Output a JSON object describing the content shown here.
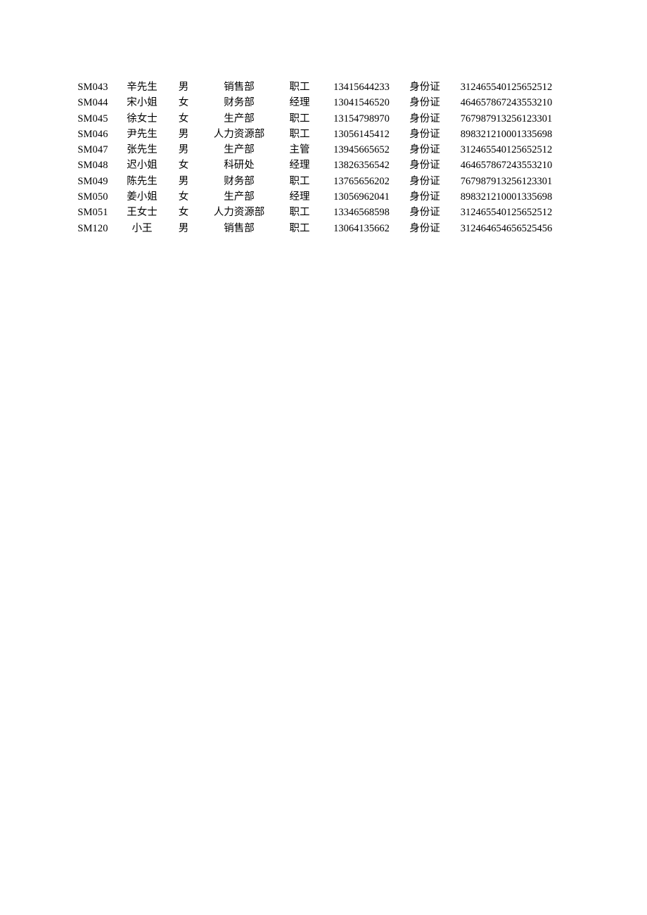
{
  "document": {
    "type": "employee-record-table",
    "page_background": "#ffffff",
    "text_color": "#000000",
    "has_header_row": false,
    "has_gridlines": false,
    "row_count": 10,
    "column_count": 7
  },
  "table": {
    "columns": [
      {
        "key": "id",
        "semantic": "employee-id"
      },
      {
        "key": "name",
        "semantic": "employee-name"
      },
      {
        "key": "gender",
        "semantic": "gender"
      },
      {
        "key": "department",
        "semantic": "department"
      },
      {
        "key": "position",
        "semantic": "position"
      },
      {
        "key": "phone",
        "semantic": "phone-number"
      },
      {
        "key": "id_type",
        "semantic": "id-document-type"
      },
      {
        "key": "id_number",
        "semantic": "id-document-number"
      }
    ],
    "rows": [
      {
        "id": "SM043",
        "name": "辛先生",
        "gender": "男",
        "department": "销售部",
        "position": "职工",
        "phone": "13415644233",
        "id_type": "身份证",
        "id_number": "312465540125652512"
      },
      {
        "id": "SM044",
        "name": "宋小姐",
        "gender": "女",
        "department": "财务部",
        "position": "经理",
        "phone": "13041546520",
        "id_type": "身份证",
        "id_number": "464657867243553210"
      },
      {
        "id": "SM045",
        "name": "徐女士",
        "gender": "女",
        "department": "生产部",
        "position": "职工",
        "phone": "13154798970",
        "id_type": "身份证",
        "id_number": "767987913256123301"
      },
      {
        "id": "SM046",
        "name": "尹先生",
        "gender": "男",
        "department": "人力资源部",
        "position": "职工",
        "phone": "13056145412",
        "id_type": "身份证",
        "id_number": "898321210001335698"
      },
      {
        "id": "SM047",
        "name": "张先生",
        "gender": "男",
        "department": "生产部",
        "position": "主管",
        "phone": "13945665652",
        "id_type": "身份证",
        "id_number": "312465540125652512"
      },
      {
        "id": "SM048",
        "name": "迟小姐",
        "gender": "女",
        "department": "科研处",
        "position": "经理",
        "phone": "13826356542",
        "id_type": "身份证",
        "id_number": "464657867243553210"
      },
      {
        "id": "SM049",
        "name": "陈先生",
        "gender": "男",
        "department": "财务部",
        "position": "职工",
        "phone": "13765656202",
        "id_type": "身份证",
        "id_number": "767987913256123301"
      },
      {
        "id": "SM050",
        "name": "姜小姐",
        "gender": "女",
        "department": "生产部",
        "position": "经理",
        "phone": "13056962041",
        "id_type": "身份证",
        "id_number": "898321210001335698"
      },
      {
        "id": "SM051",
        "name": "王女士",
        "gender": "女",
        "department": "人力资源部",
        "position": "职工",
        "phone": "13346568598",
        "id_type": "身份证",
        "id_number": "312465540125652512"
      },
      {
        "id": "SM120",
        "name": "小王",
        "gender": "男",
        "department": "销售部",
        "position": "职工",
        "phone": "13064135662",
        "id_type": "身份证",
        "id_number": "312464654656525456"
      }
    ]
  }
}
